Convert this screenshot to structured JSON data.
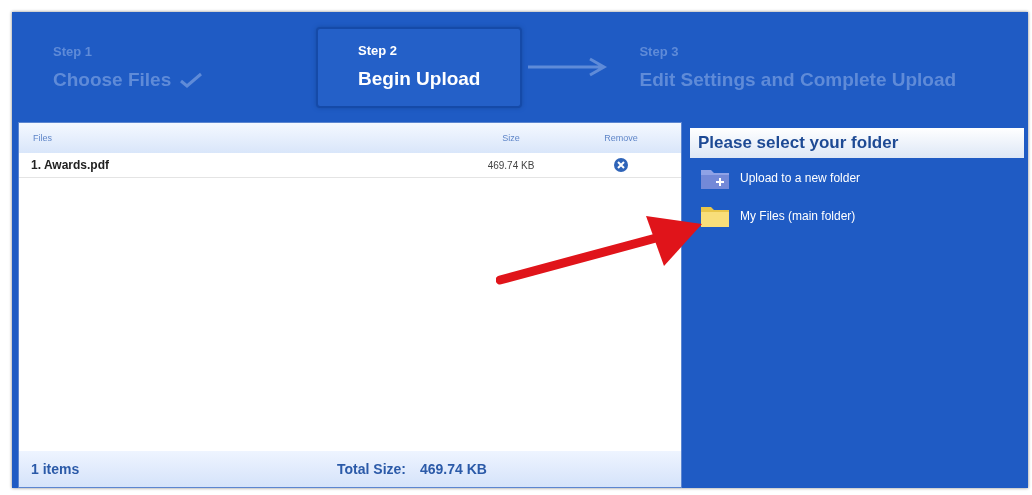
{
  "steps": [
    {
      "label": "Step 1",
      "title": "Choose Files",
      "completed": true,
      "selected": false
    },
    {
      "label": "Step 2",
      "title": "Begin Upload",
      "completed": false,
      "selected": true
    },
    {
      "label": "Step 3",
      "title": "Edit Settings and Complete Upload",
      "completed": false,
      "selected": false
    }
  ],
  "files": {
    "columns": [
      "Files",
      "Size",
      "Remove"
    ],
    "rows": [
      {
        "name": "1. Awards.pdf",
        "size": "469.74 KB"
      }
    ],
    "footer": {
      "count": "1 items",
      "total_label": "Total Size:",
      "total_value": "469.74 KB"
    }
  },
  "folders": {
    "title": "Please select your folder",
    "items": [
      {
        "label": "Upload to a new folder",
        "kind": "new"
      },
      {
        "label": "My Files (main folder)",
        "kind": "main"
      }
    ]
  }
}
